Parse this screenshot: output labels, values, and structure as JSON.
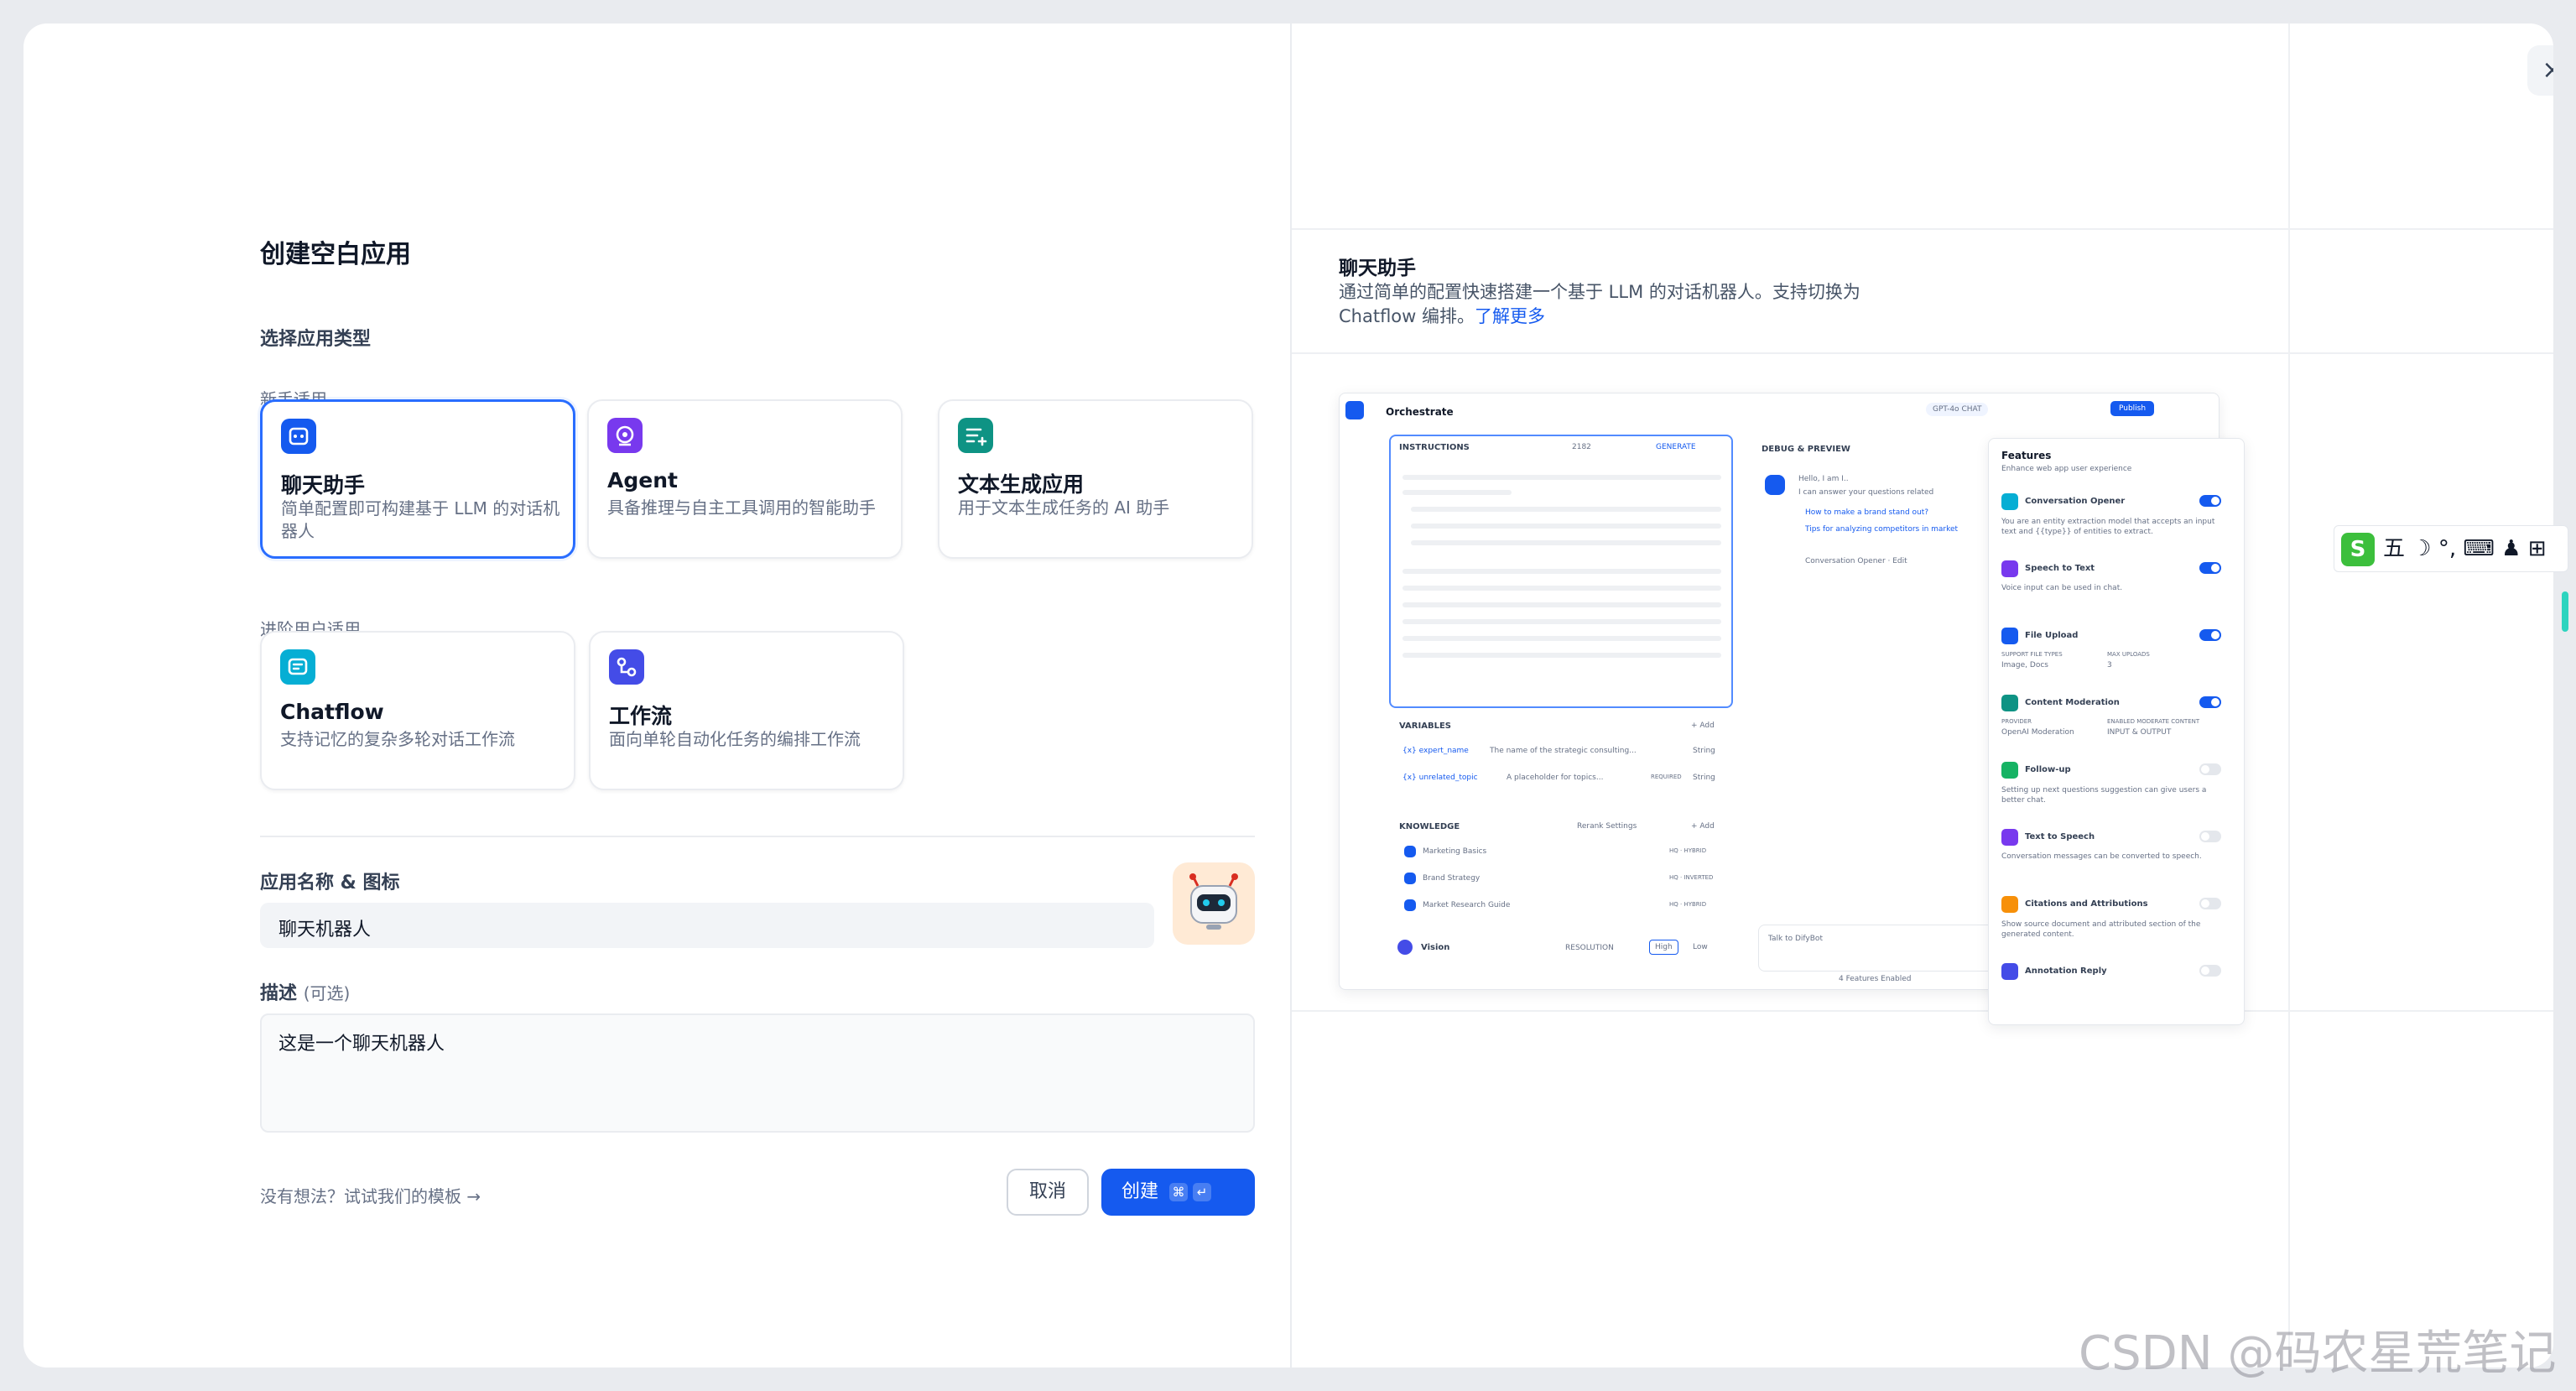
{
  "title": "创建空白应用",
  "section_label": "选择应用类型",
  "beginner_label": "新手适用",
  "advanced_label": "进阶用户适用",
  "cards": {
    "chat": {
      "title": "聊天助手",
      "desc": "简单配置即可构建基于 LLM 的对话机器人",
      "icon": "chat-bot-icon",
      "color": "#155aef"
    },
    "agent": {
      "title": "Agent",
      "desc": "具备推理与自主工具调用的智能助手",
      "icon": "agent-icon",
      "color": "#7839ee"
    },
    "text": {
      "title": "文本生成应用",
      "desc": "用于文本生成任务的 AI 助手",
      "icon": "text-generation-icon",
      "color": "#0e9384"
    },
    "chatflow": {
      "title": "Chatflow",
      "desc": "支持记忆的复杂多轮对话工作流",
      "icon": "chatflow-icon",
      "color": "#06aed4"
    },
    "workflow": {
      "title": "工作流",
      "desc": "面向单轮自动化任务的编排工作流",
      "icon": "workflow-icon",
      "color": "#444ce7"
    }
  },
  "name_label": "应用名称 & 图标",
  "name_value": "聊天机器人",
  "desc_label": "描述",
  "desc_optional": "(可选)",
  "desc_value": "这是一个聊天机器人",
  "hint": "没有想法？试试我们的模板 →",
  "cancel": "取消",
  "create": "创建",
  "create_kbd": [
    "⌘",
    "↵"
  ],
  "preview": {
    "title": "聊天助手",
    "desc": "通过简单的配置快速搭建一个基于 LLM 的对话机器人。支持切换为 Chatflow 编排。",
    "link": "了解更多",
    "orchestrate": "Orchestrate",
    "model": "GPT-4o",
    "model_tag": "CHAT",
    "publish": "Publish",
    "instructions": "INSTRUCTIONS",
    "instr_count": "2182",
    "generate": "GENERATE",
    "debug": "DEBUG & PREVIEW",
    "bot_hello": "Hello, I am I..",
    "bot_line": "I can answer your questions related",
    "sugg1": "How to make a brand stand out?",
    "sugg2": "Tips for analyzing competitors in market",
    "opener_note": "Conversation Opener · Edit",
    "talk": "Talk to DifyBot",
    "features_enabled": "4 Features Enabled",
    "variables": "VARIABLES",
    "add": "+ Add",
    "var1": "{x} expert_name",
    "var1_desc": "The name of the strategic consulting...",
    "var1_type": "String",
    "var2": "{x} unrelated_topic",
    "var2_desc": "A placeholder for topics...",
    "var2_req": "REQUIRED",
    "var2_type": "String",
    "knowledge": "KNOWLEDGE",
    "rerank": "Rerank Settings",
    "kb1": "Marketing Basics",
    "kb1_tag": "HQ · HYBRID",
    "kb2": "Brand Strategy",
    "kb2_tag": "HQ · INVERTED",
    "kb3": "Market Research Guide",
    "kb3_tag": "HQ · HYBRID",
    "vision": "Vision",
    "resolution": "RESOLUTION",
    "high": "High",
    "low": "Low",
    "features": "Features",
    "features_sub": "Enhance web app user experience",
    "f1": "Conversation Opener",
    "f1_desc": "You are an entity extraction model that accepts an input text and {{type}} of entities to extract.",
    "f2": "Speech to Text",
    "f2_desc": "Voice input can be used in chat.",
    "f3": "File Upload",
    "f3_k1": "SUPPORT FILE TYPES",
    "f3_v1": "Image, Docs",
    "f3_k2": "MAX UPLOADS",
    "f3_v2": "3",
    "f4": "Content Moderation",
    "f4_k1": "PROVIDER",
    "f4_v1": "OpenAI Moderation",
    "f4_k2": "ENABLED MODERATE CONTENT",
    "f4_v2": "INPUT & OUTPUT",
    "f5": "Follow-up",
    "f5_desc": "Setting up next questions suggestion can give users a better chat.",
    "f6": "Text to Speech",
    "f6_desc": "Conversation messages can be converted to speech.",
    "f7": "Citations and Attributions",
    "f7_desc": "Show source document and attributed section of the generated content.",
    "f8": "Annotation Reply"
  },
  "ime": {
    "glyph": "S",
    "chars": "五 ☽ °, ⌨ ♟ ⊞"
  },
  "watermark": "CSDN @码农星荒笔记"
}
